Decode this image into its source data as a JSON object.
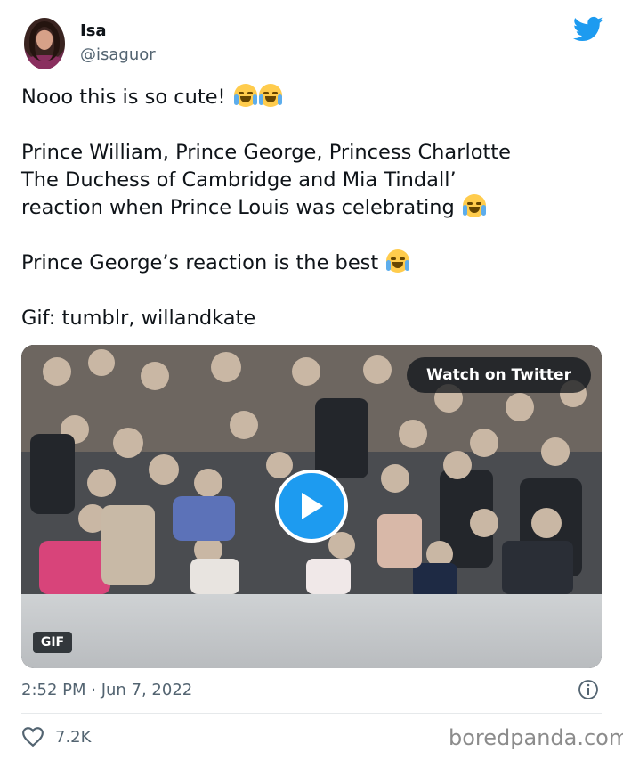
{
  "author": {
    "name": "Isa",
    "handle": "@isaguor"
  },
  "tweet": {
    "lines": [
      "Nooo this is so cute!",
      "Prince William, Prince George, Princess Charlotte",
      "The Duchess of Cambridge and Mia Tindall’",
      "reaction when Prince Louis was celebrating",
      "Prince George’s reaction is the best",
      "Gif: tumblr, willandkate"
    ]
  },
  "media": {
    "watch_label": "Watch on Twitter",
    "gif_label": "GIF"
  },
  "footer": {
    "timestamp": "2:52 PM · Jun 7, 2022",
    "likes": "7.2K",
    "watermark": "boredpanda.com"
  },
  "colors": {
    "twitter_blue": "#1d9bf0",
    "secondary_text": "#536471"
  },
  "icons": [
    "twitter-bird-icon",
    "play-icon",
    "info-icon",
    "heart-icon",
    "loudly-crying-face-emoji",
    "tears-of-joy-emoji"
  ]
}
